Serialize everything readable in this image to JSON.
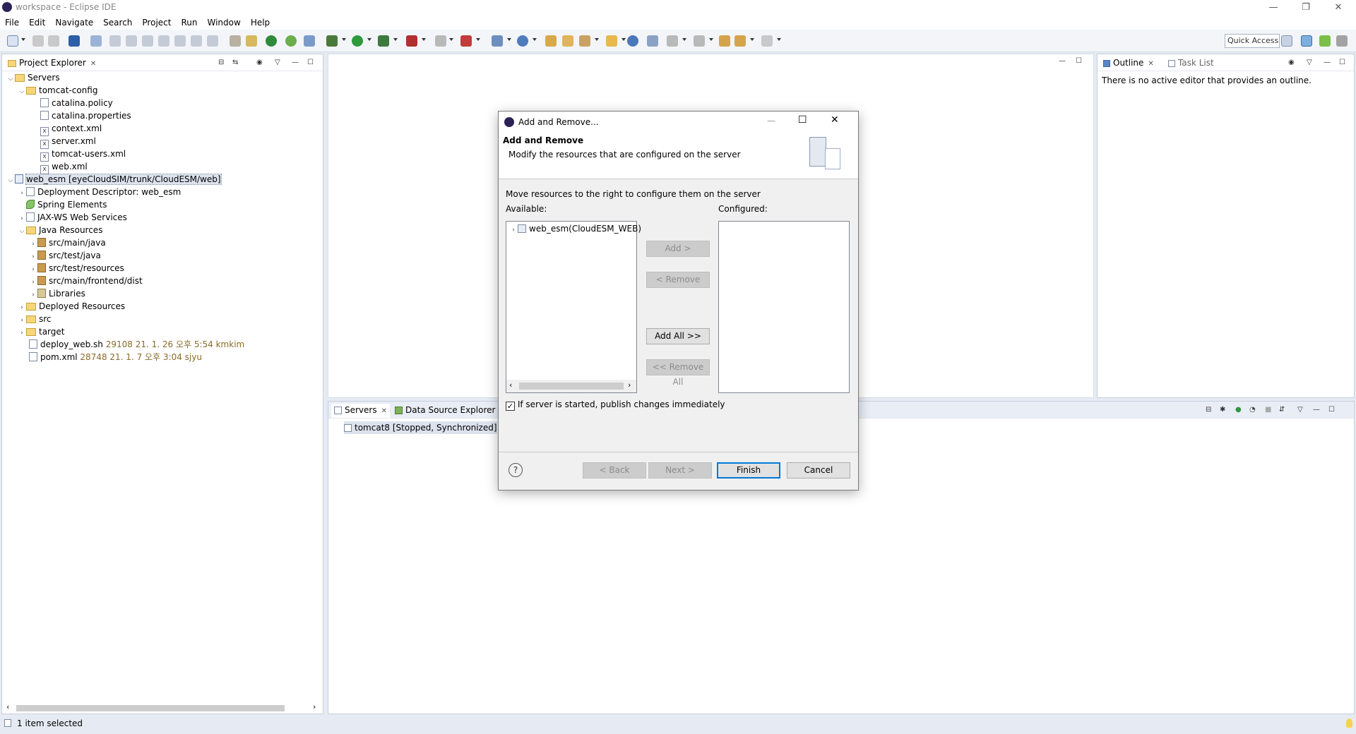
{
  "window": {
    "title": "workspace - Eclipse IDE",
    "minimize": "—",
    "restore": "❐",
    "close": "✕"
  },
  "menu": [
    "File",
    "Edit",
    "Navigate",
    "Search",
    "Project",
    "Run",
    "Window",
    "Help"
  ],
  "toolbar": {
    "quick_access": "Quick Access"
  },
  "project_explorer": {
    "tab_label": "Project Explorer",
    "tab_close": "✕",
    "rows": [
      {
        "label": "Servers",
        "decor": ""
      },
      {
        "label": "tomcat-config",
        "decor": ""
      },
      {
        "label": "catalina.policy",
        "decor": ""
      },
      {
        "label": "catalina.properties",
        "decor": ""
      },
      {
        "label": "context.xml",
        "decor": ""
      },
      {
        "label": "server.xml",
        "decor": ""
      },
      {
        "label": "tomcat-users.xml",
        "decor": ""
      },
      {
        "label": "web.xml",
        "decor": ""
      },
      {
        "label": "web_esm [eyeCloudSIM/trunk/CloudESM/web]",
        "decor": ""
      },
      {
        "label": "Deployment Descriptor: web_esm",
        "decor": ""
      },
      {
        "label": "Spring Elements",
        "decor": ""
      },
      {
        "label": "JAX-WS Web Services",
        "decor": ""
      },
      {
        "label": "Java Resources",
        "decor": ""
      },
      {
        "label": "src/main/java",
        "decor": ""
      },
      {
        "label": "src/test/java",
        "decor": ""
      },
      {
        "label": "src/test/resources",
        "decor": ""
      },
      {
        "label": "src/main/frontend/dist",
        "decor": ""
      },
      {
        "label": "Libraries",
        "decor": ""
      },
      {
        "label": "Deployed Resources",
        "decor": ""
      },
      {
        "label": "src",
        "decor": ""
      },
      {
        "label": "target",
        "decor": ""
      },
      {
        "label": "deploy_web.sh",
        "decor": "29108  21. 1. 26 오후 5:54  kmkim"
      },
      {
        "label": "pom.xml",
        "decor": "28748  21. 1. 7 오후 3:04  sjyu"
      }
    ]
  },
  "outline": {
    "tab_label": "Outline",
    "tab_close": "✕",
    "task_list_label": "Task List",
    "message": "There is no active editor that provides an outline."
  },
  "servers_view": {
    "tab_label": "Servers",
    "tab_close": "✕",
    "datasource_label": "Data Source Explorer",
    "server_row": "tomcat8  [Stopped, Synchronized]"
  },
  "dialog": {
    "title": "Add and Remove...",
    "heading": "Add and Remove",
    "subheading": "Modify the resources that are configured on the server",
    "instruction": "Move resources to the right to configure them on the server",
    "available_label": "Available:",
    "configured_label": "Configured:",
    "available_items": [
      "web_esm(CloudESM_WEB)"
    ],
    "add_button": "Add >",
    "remove_button": "< Remove",
    "add_all_button": "Add All >>",
    "remove_all_button": "<< Remove All",
    "publish_checkbox": "If server is started, publish changes immediately",
    "publish_checked": true,
    "back_button": "< Back",
    "next_button": "Next >",
    "finish_button": "Finish",
    "cancel_button": "Cancel",
    "help": "?",
    "close": "✕",
    "minimize": "—",
    "maximize": "☐"
  },
  "statusbar": {
    "text": "1 item selected"
  }
}
